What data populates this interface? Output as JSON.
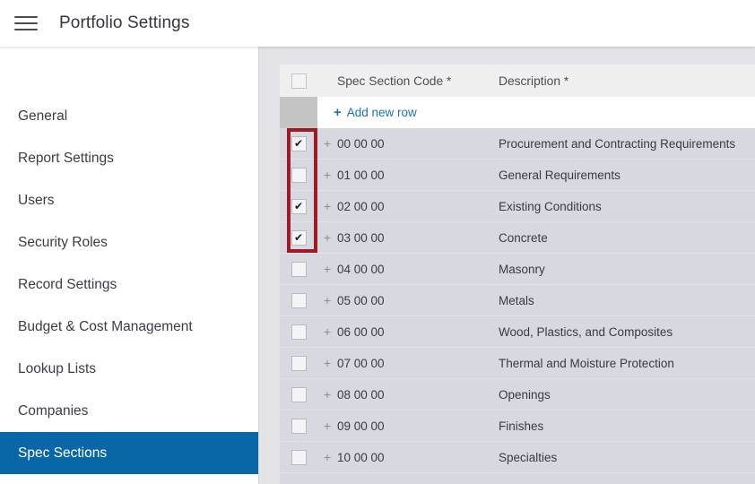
{
  "window": {
    "title": "Portfolio Settings",
    "menu_icon": "hamburger-icon"
  },
  "theme": {
    "accent_blue": "#0a67a7",
    "link_blue": "#1b72b8",
    "focus_red": "#9c1b25",
    "row_bg": "#d8d8e0",
    "header_bg": "#efefef"
  },
  "sidebar": {
    "items": [
      {
        "label": "General",
        "active": false
      },
      {
        "label": "Report Settings",
        "active": false
      },
      {
        "label": "Users",
        "active": false
      },
      {
        "label": "Security Roles",
        "active": false
      },
      {
        "label": "Record Settings",
        "active": false
      },
      {
        "label": "Budget & Cost Management",
        "active": false
      },
      {
        "label": "Lookup Lists",
        "active": false
      },
      {
        "label": "Companies",
        "active": false
      },
      {
        "label": "Spec Sections",
        "active": true
      }
    ]
  },
  "grid": {
    "columns": {
      "code": "Spec Section Code *",
      "description": "Description *"
    },
    "select_all_checked": false,
    "add_new_row_label": "Add new row",
    "add_new_row_plus": "+",
    "expand_icon": "+",
    "rows": [
      {
        "checked": true,
        "code": "00 00 00",
        "description": "Procurement and Contracting Requirements"
      },
      {
        "checked": false,
        "code": "01 00 00",
        "description": "General Requirements"
      },
      {
        "checked": true,
        "code": "02 00 00",
        "description": "Existing Conditions"
      },
      {
        "checked": true,
        "code": "03 00 00",
        "description": "Concrete"
      },
      {
        "checked": false,
        "code": "04 00 00",
        "description": "Masonry"
      },
      {
        "checked": false,
        "code": "05 00 00",
        "description": "Metals"
      },
      {
        "checked": false,
        "code": "06 00 00",
        "description": "Wood, Plastics, and Composites"
      },
      {
        "checked": false,
        "code": "07 00 00",
        "description": "Thermal and Moisture Protection"
      },
      {
        "checked": false,
        "code": "08 00 00",
        "description": "Openings"
      },
      {
        "checked": false,
        "code": "09 00 00",
        "description": "Finishes"
      },
      {
        "checked": false,
        "code": "10 00 00",
        "description": "Specialties"
      }
    ]
  }
}
